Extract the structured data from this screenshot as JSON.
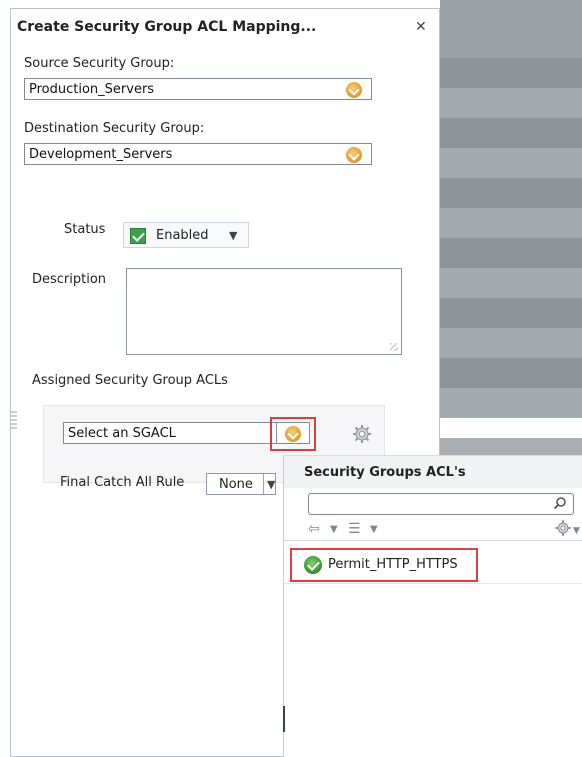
{
  "dialog": {
    "title": "Create Security Group ACL Mapping...",
    "close_glyph": "✕"
  },
  "form": {
    "source_label": "Source Security Group:",
    "source_value": "Production_Servers",
    "destination_label": "Destination Security Group:",
    "destination_value": "Development_Servers",
    "status_label": "Status",
    "status_value": "Enabled",
    "description_label": "Description",
    "description_value": "",
    "assigned_label": "Assigned Security Group ACLs",
    "sgacl_placeholder": "Select an SGACL",
    "final_rule_label": "Final Catch All Rule",
    "final_rule_value": "None"
  },
  "popup": {
    "title": "Security Groups ACL's",
    "search_value": "",
    "items": [
      {
        "label": "Permit_HTTP_HTTPS"
      }
    ]
  },
  "icons": {
    "dropdown": "chevron-down-circle-icon",
    "settings": "gear-icon",
    "back": "back-arrow-icon",
    "list": "list-icon",
    "search": "search-icon",
    "status_check": "checkmark-icon",
    "item_check": "check-circle-icon"
  },
  "colors": {
    "accent_orange": "#e0982d",
    "highlight_red": "#d64040",
    "status_green": "#3aa34a"
  }
}
